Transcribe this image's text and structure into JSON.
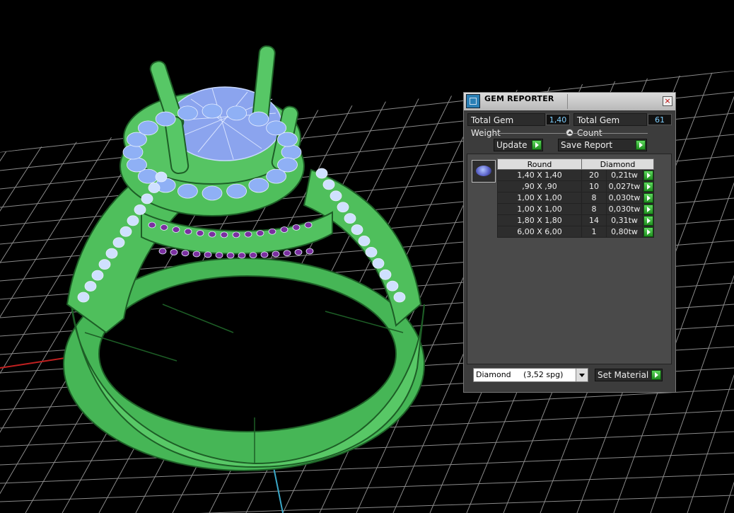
{
  "panel": {
    "title": "GEM REPORTER",
    "total_gem_weight_label": "Total Gem Weight",
    "total_gem_weight_value": "1,40",
    "total_gem_count_label": "Total Gem Count",
    "total_gem_count_value": "61",
    "update_label": "Update",
    "save_report_label": "Save Report",
    "table": {
      "headers": [
        "Round",
        "Diamond"
      ],
      "rows": [
        {
          "size": "1,40 X 1,40",
          "count": "20",
          "weight": "0,21tw"
        },
        {
          "size": ",90 X ,90",
          "count": "10",
          "weight": "0,027tw"
        },
        {
          "size": "1,00 X 1,00",
          "count": "8",
          "weight": "0,030tw"
        },
        {
          "size": "1,00 X 1,00",
          "count": "8",
          "weight": "0,030tw"
        },
        {
          "size": "1,80 X 1,80",
          "count": "14",
          "weight": "0,31tw"
        },
        {
          "size": "6,00 X 6,00",
          "count": "1",
          "weight": "0,80tw"
        }
      ]
    },
    "material_select": "Diamond     (3,52 spg)",
    "set_material_label": "Set Material",
    "close_glyph": "×"
  },
  "colors": {
    "ring_green": "#4fbf5c",
    "gem_blue": "#8fb0f5",
    "gem_purple": "#7b2fa0",
    "grid": "#9a9a9a",
    "axis_red": "#c02020",
    "axis_blue": "#3aa8c8"
  }
}
